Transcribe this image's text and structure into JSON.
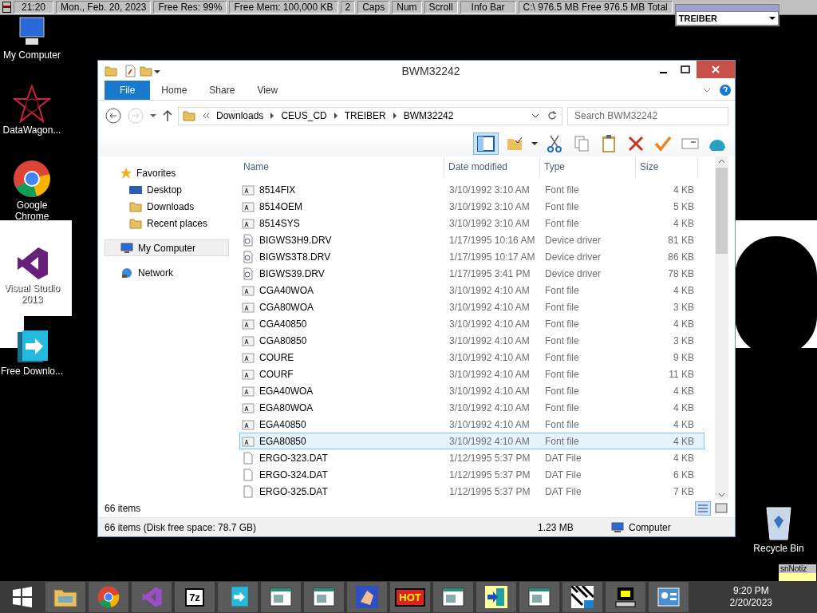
{
  "info_bar": {
    "items": [
      "21:20",
      "Mon., Feb. 20, 2023",
      "Free Res: 99%",
      "Free Mem: 100,000 KB",
      "2",
      "Caps",
      "Num",
      "Scroll",
      "Info Bar",
      "C:\\ 976.5 MB Free  976.5 MB Total"
    ]
  },
  "drive_widget": {
    "value": "TREIBER"
  },
  "desktop_icons": [
    {
      "label": "My Computer",
      "kind": "computer"
    },
    {
      "label": "DataWagon...",
      "kind": "star"
    },
    {
      "label": "Google Chrome",
      "kind": "chrome"
    },
    {
      "label": "Visual Studio 2013",
      "kind": "vs"
    },
    {
      "label": "Free Downlo...",
      "kind": "download"
    }
  ],
  "recycle_bin": {
    "label": "Recycle Bin"
  },
  "explorer": {
    "title": "BWM32242",
    "ribbon_tabs": [
      {
        "label": "File",
        "kind": "file",
        "selected": false
      },
      {
        "label": "Home",
        "kind": "tab",
        "selected": false
      },
      {
        "label": "Share",
        "kind": "tab",
        "selected": false
      },
      {
        "label": "View",
        "kind": "tab",
        "selected": false
      }
    ],
    "breadcrumb": [
      "Downloads",
      "CEUS_CD",
      "TREIBER",
      "BWM32242"
    ],
    "search": {
      "placeholder": "Search BWM32242"
    },
    "nav": [
      {
        "label": "Favorites",
        "kind": "star",
        "selected": false,
        "children": [
          {
            "label": "Desktop",
            "kind": "desktop",
            "selected": false
          },
          {
            "label": "Downloads",
            "kind": "folder",
            "selected": false
          },
          {
            "label": "Recent places",
            "kind": "folder",
            "selected": false
          }
        ]
      },
      {
        "label": "My Computer",
        "kind": "computer",
        "selected": true
      },
      {
        "label": "Network",
        "kind": "network",
        "selected": false
      }
    ],
    "columns": [
      "Name",
      "Date modified",
      "Type",
      "Size"
    ],
    "rows": [
      {
        "name": "8514FIX",
        "date": "3/10/1992 3:10 AM",
        "type": "Font file",
        "size": "4 KB",
        "kind": "font",
        "selected": false
      },
      {
        "name": "8514OEM",
        "date": "3/10/1992 3:10 AM",
        "type": "Font file",
        "size": "5 KB",
        "kind": "font",
        "selected": false
      },
      {
        "name": "8514SYS",
        "date": "3/10/1992 3:10 AM",
        "type": "Font file",
        "size": "4 KB",
        "kind": "font",
        "selected": false
      },
      {
        "name": "BIGWS3H9.DRV",
        "date": "1/17/1995 10:16 AM",
        "type": "Device driver",
        "size": "81 KB",
        "kind": "driver",
        "selected": false
      },
      {
        "name": "BIGWS3T8.DRV",
        "date": "1/17/1995 10:17 AM",
        "type": "Device driver",
        "size": "86 KB",
        "kind": "driver",
        "selected": false
      },
      {
        "name": "BIGWS39.DRV",
        "date": "1/17/1995 3:41 PM",
        "type": "Device driver",
        "size": "78 KB",
        "kind": "driver",
        "selected": false
      },
      {
        "name": "CGA40WOA",
        "date": "3/10/1992 4:10 AM",
        "type": "Font file",
        "size": "4 KB",
        "kind": "font",
        "selected": false
      },
      {
        "name": "CGA80WOA",
        "date": "3/10/1992 4:10 AM",
        "type": "Font file",
        "size": "3 KB",
        "kind": "font",
        "selected": false
      },
      {
        "name": "CGA40850",
        "date": "3/10/1992 4:10 AM",
        "type": "Font file",
        "size": "4 KB",
        "kind": "font",
        "selected": false
      },
      {
        "name": "CGA80850",
        "date": "3/10/1992 4:10 AM",
        "type": "Font file",
        "size": "3 KB",
        "kind": "font",
        "selected": false
      },
      {
        "name": "COURE",
        "date": "3/10/1992 4:10 AM",
        "type": "Font file",
        "size": "9 KB",
        "kind": "font",
        "selected": false
      },
      {
        "name": "COURF",
        "date": "3/10/1992 4:10 AM",
        "type": "Font file",
        "size": "11 KB",
        "kind": "font",
        "selected": false
      },
      {
        "name": "EGA40WOA",
        "date": "3/10/1992 4:10 AM",
        "type": "Font file",
        "size": "4 KB",
        "kind": "font",
        "selected": false
      },
      {
        "name": "EGA80WOA",
        "date": "3/10/1992 4:10 AM",
        "type": "Font file",
        "size": "4 KB",
        "kind": "font",
        "selected": false
      },
      {
        "name": "EGA40850",
        "date": "3/10/1992 4:10 AM",
        "type": "Font file",
        "size": "4 KB",
        "kind": "font",
        "selected": false
      },
      {
        "name": "EGA80850",
        "date": "3/10/1992 4:10 AM",
        "type": "Font file",
        "size": "4 KB",
        "kind": "font",
        "selected": true
      },
      {
        "name": "ERGO-323.DAT",
        "date": "1/12/1995 5:37 PM",
        "type": "DAT File",
        "size": "4 KB",
        "kind": "dat",
        "selected": false
      },
      {
        "name": "ERGO-324.DAT",
        "date": "1/12/1995 5:37 PM",
        "type": "DAT File",
        "size": "6 KB",
        "kind": "dat",
        "selected": false
      },
      {
        "name": "ERGO-325.DAT",
        "date": "1/12/1995 5:37 PM",
        "type": "DAT File",
        "size": "7 KB",
        "kind": "dat",
        "selected": false
      }
    ],
    "item_count": "66 items",
    "status": {
      "summary": "66 items (Disk free space: 78.7 GB)",
      "size": "1.23 MB",
      "location": "Computer"
    }
  },
  "taskbar": {
    "apps": [
      {
        "kind": "explorer"
      },
      {
        "kind": "chrome"
      },
      {
        "kind": "vs"
      },
      {
        "kind": "text",
        "label": "7z"
      },
      {
        "kind": "download"
      },
      {
        "kind": "window"
      },
      {
        "kind": "window"
      },
      {
        "kind": "hand"
      },
      {
        "kind": "text",
        "label": "HOT"
      },
      {
        "kind": "window"
      },
      {
        "kind": "exit"
      },
      {
        "kind": "window"
      },
      {
        "kind": "piano"
      },
      {
        "kind": "pc"
      },
      {
        "kind": "panel"
      }
    ],
    "clock": {
      "time": "9:20 PM",
      "date": "2/20/2023"
    }
  },
  "sticky_note": {
    "title": "snNotiz"
  }
}
